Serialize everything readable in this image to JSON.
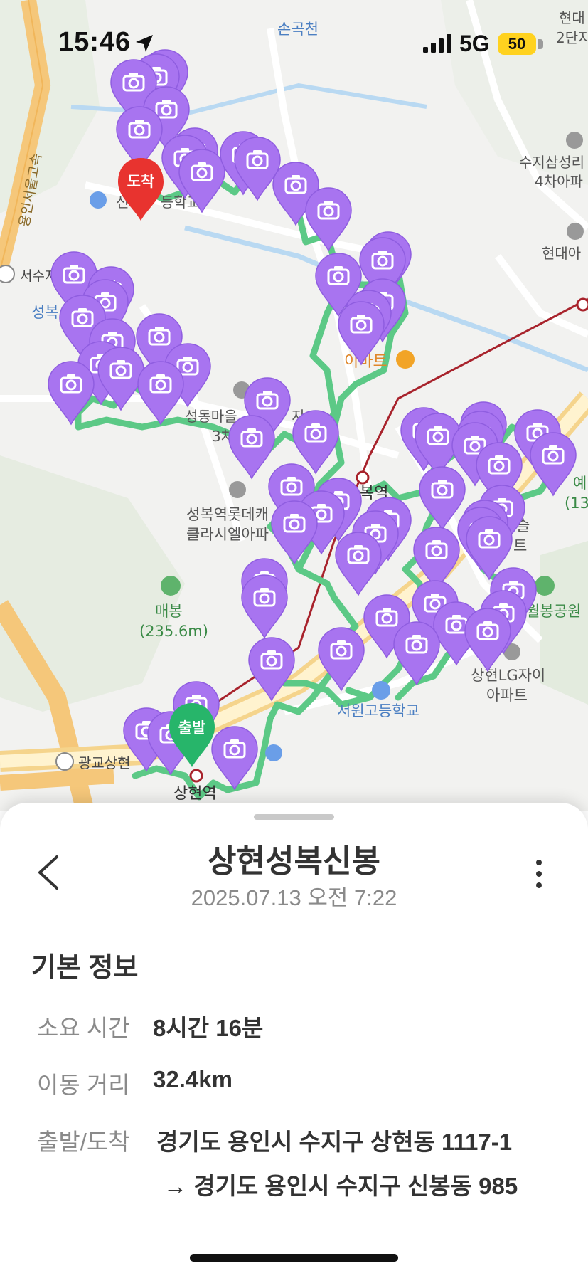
{
  "status_bar": {
    "time": "15:46",
    "network": "5G",
    "battery": "50"
  },
  "map": {
    "start_marker_label": "출발",
    "end_marker_label": "도착",
    "labels": {
      "stream": "손곡천",
      "apt_hyundai2": "현대",
      "apt_hyundai2_b": "2단지",
      "apt_suji": "수지삼성리",
      "apt_suji_b": "4차아파",
      "apt_hyundaia": "현대아",
      "expressway": "용인서울고속",
      "ic_seosu": "서수지",
      "ic_gwanggyo": "광교상현",
      "seongbok": "성복",
      "school_top": "신",
      "school_top_b": "등학교",
      "emart": "이마트",
      "seongdong": "성동마을",
      "seongdong_b": "지",
      "seongdong_c": "3차",
      "lotte_apt": "성복역롯데캐",
      "lotte_apt_b": "클라시엘아파",
      "station_seongbok": "복역",
      "maebong": "매봉",
      "maebong_h": "(235.6m)",
      "park": "월봉공원",
      "lg_apt": "상현LG자이",
      "lg_apt_b": "아파트",
      "school_seowon": "서원고등학교",
      "station_sanghyeon": "상현역",
      "right_edge": "예",
      "right_edge_b": "(13",
      "apt_right": "슬",
      "apt_right_b": "트"
    }
  },
  "sheet": {
    "title": "상현성복신봉",
    "datetime": "2025.07.13  오전 7:22",
    "section_title": "기본 정보",
    "rows": [
      {
        "label": "소요 시간",
        "value": "8시간 16분"
      },
      {
        "label": "이동 거리",
        "value": "32.4km"
      },
      {
        "label": "출발/도착",
        "value": "경기도 용인시 수지구 상현동 1117-1"
      }
    ],
    "arrival_address": "→ 경기도 용인시 수지구 신봉동 985"
  },
  "colors": {
    "route": "#5cc986",
    "photo_pin": "#a874f0",
    "end_pin": "#e8332f",
    "start_pin": "#27b56a"
  }
}
